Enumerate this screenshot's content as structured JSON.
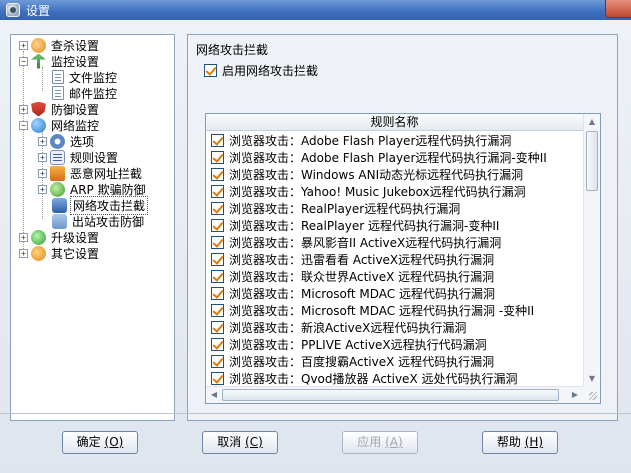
{
  "window": {
    "title": "设置"
  },
  "tree": {
    "items": [
      {
        "label": "查杀设置",
        "icon": "search-icon"
      },
      {
        "label": "监控设置",
        "icon": "umbrella-icon"
      },
      {
        "label": "文件监控",
        "icon": "file-icon"
      },
      {
        "label": "邮件监控",
        "icon": "mail-icon"
      },
      {
        "label": "防御设置",
        "icon": "shield-icon"
      },
      {
        "label": "网络监控",
        "icon": "globe-icon"
      },
      {
        "label": "选项",
        "icon": "gear-icon"
      },
      {
        "label": "规则设置",
        "icon": "list-icon"
      },
      {
        "label": "恶意网址拦截",
        "icon": "block-icon"
      },
      {
        "label": "ARP 欺骗防御",
        "icon": "arp-icon"
      },
      {
        "label": "网络攻击拦截",
        "icon": "network-attack-icon"
      },
      {
        "label": "出站攻击防御",
        "icon": "outbound-icon"
      },
      {
        "label": "升级设置",
        "icon": "upgrade-icon"
      },
      {
        "label": "其它设置",
        "icon": "other-settings-icon"
      }
    ],
    "selected": "网络攻击拦截"
  },
  "panel": {
    "title": "网络攻击拦截",
    "enable_label": "启用网络攻击拦截",
    "enable_checked": true,
    "column_header": "规则名称",
    "rules": [
      "浏览器攻击：Adobe Flash Player远程代码执行漏洞",
      "浏览器攻击：Adobe Flash Player远程代码执行漏洞-变种II",
      "浏览器攻击：Windows ANI动态光标远程代码执行漏洞",
      "浏览器攻击：Yahoo! Music Jukebox远程代码执行漏洞",
      "浏览器攻击：RealPlayer远程代码执行漏洞",
      "浏览器攻击：RealPlayer 远程代码执行漏洞-变种II",
      "浏览器攻击：暴风影音II ActiveX远程代码执行漏洞",
      "浏览器攻击：迅雷看看 ActiveX远程代码执行漏洞",
      "浏览器攻击：联众世界ActiveX 远程代码执行漏洞",
      "浏览器攻击：Microsoft MDAC 远程代码执行漏洞",
      "浏览器攻击：Microsoft MDAC 远程代码执行漏洞 -变种II",
      "浏览器攻击：新浪ActiveX远程代码执行漏洞",
      "浏览器攻击：PPLIVE ActiveX远程执行代码漏洞",
      "浏览器攻击：百度搜霸ActiveX 远程代码执行漏洞",
      "浏览器攻击：Qvod播放器 ActiveX 远处代码执行漏洞"
    ]
  },
  "buttons": {
    "ok": {
      "label": "确定",
      "accel": "(O)"
    },
    "cancel": {
      "label": "取消",
      "accel": "(C)"
    },
    "apply": {
      "label": "应用",
      "accel": "(A)"
    },
    "help": {
      "label": "帮助",
      "accel": "(H)"
    }
  },
  "colors": {
    "titlebar": "#3d6fbd",
    "check_mark": "#e07a00",
    "border": "#8da2bd"
  }
}
